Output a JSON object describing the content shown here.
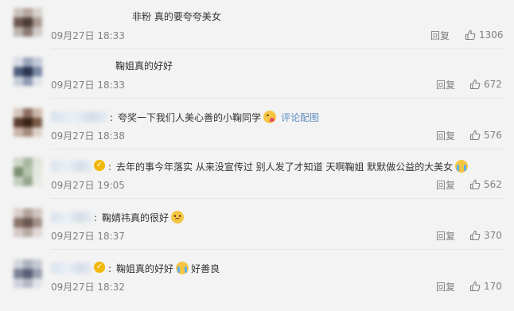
{
  "colors": {
    "background": "#f3f3f3",
    "text": "#333333",
    "meta_text": "#808080",
    "link": "#5f8cc0",
    "vip_badge": "#f2b705",
    "divider": "#e6e6e6"
  },
  "comments": [
    {
      "has_name": false,
      "vip": false,
      "text": "非粉 真的要夸夸美女",
      "time": "09月27日 18:33",
      "reply_label": "回复",
      "likes": "1306",
      "avatar_colors": [
        "#c9c2bd",
        "#b9a7a0",
        "#d5cfcb",
        "#6c5550",
        "#4a3c38",
        "#a89890",
        "#bbb3ae",
        "#8b7a72",
        "#d0cac6"
      ]
    },
    {
      "has_name": false,
      "vip": false,
      "text": "鞠姐真的好好",
      "time": "09月27日 18:33",
      "reply_label": "回复",
      "likes": "672",
      "avatar_colors": [
        "#d7dbe3",
        "#9aa5bb",
        "#c3cad8",
        "#4f5d7a",
        "#2b3550",
        "#7887a3",
        "#c6ccd8",
        "#8d9ab2",
        "#dfe3ea"
      ]
    },
    {
      "has_name": true,
      "vip": false,
      "text": "夸奖一下我们人美心善的小鞠同学",
      "emoji": "kiss",
      "link_text": "评论配图",
      "time": "09月27日 18:38",
      "reply_label": "回复",
      "likes": "576",
      "avatar_colors": [
        "#d5c6bd",
        "#8f6f5f",
        "#cdb8ab",
        "#5b3a2c",
        "#3a2418",
        "#7b5a48",
        "#c9b5a8",
        "#a68a7a",
        "#ddd0c7"
      ]
    },
    {
      "has_name": true,
      "vip": true,
      "text": "去年的事今年落实 从来没宣传过 别人发了才知道 天啊鞠姐 默默做公益的大美女",
      "emoji": "cry",
      "time": "09月27日 19:05",
      "reply_label": "回复",
      "likes": "562",
      "avatar_colors": [
        "#cfd6c9",
        "#a9b7a0",
        "#dfe4da",
        "#7a8f70",
        "#b6c3ad",
        "#e3e8de",
        "#c4cebd",
        "#98a88e",
        "#e8ece4"
      ]
    },
    {
      "has_name": true,
      "vip": false,
      "text": "鞠婧祎真的很好",
      "emoji": "sad",
      "time": "09月27日 18:37",
      "reply_label": "回复",
      "likes": "370",
      "avatar_colors": [
        "#d8cfcb",
        "#b3a29c",
        "#cfc3bf",
        "#8a736b",
        "#6b5650",
        "#a3918a",
        "#d4c9c5",
        "#b8aaa4",
        "#e0d8d5"
      ]
    },
    {
      "has_name": true,
      "vip": true,
      "text": "鞠姐真的好好",
      "emoji": "cry",
      "text_after_emoji": "好善良",
      "time": "09月27日 18:32",
      "reply_label": "回复",
      "likes": "170",
      "avatar_colors": [
        "#d3d5dd",
        "#aeb2c0",
        "#c8cbd4",
        "#7c8196",
        "#5a5f74",
        "#9a9fb0",
        "#cfd2db",
        "#b5b8c5",
        "#e2e4ea"
      ]
    }
  ]
}
